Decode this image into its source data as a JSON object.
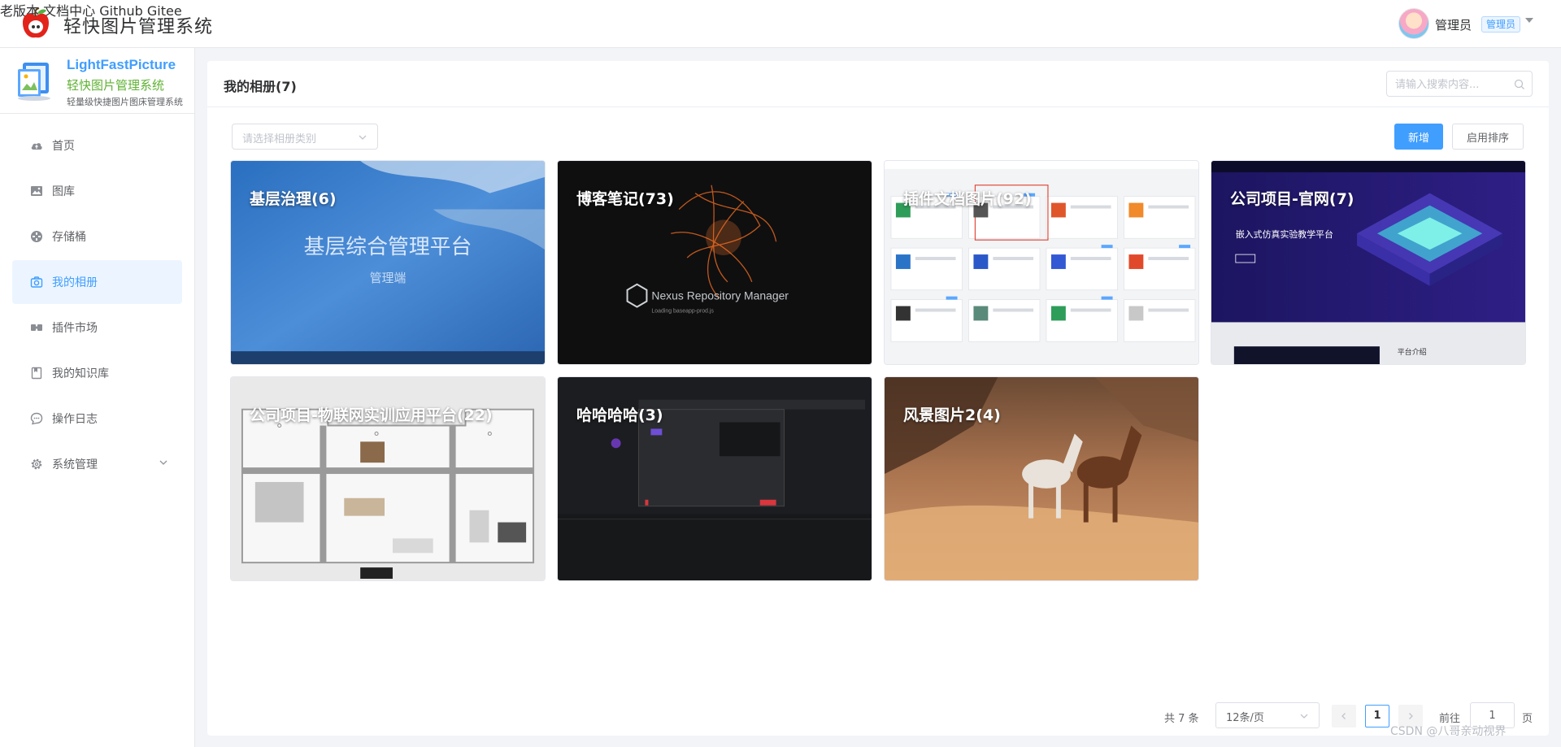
{
  "app": {
    "title": "轻快图片管理系统"
  },
  "topnav": {
    "links": [
      "老版本",
      "文档中心",
      "Github",
      "Gitee"
    ],
    "user_name": "管理员",
    "user_role": "管理员"
  },
  "sidebar": {
    "brand_en": "LightFastPicture",
    "brand_cn": "轻快图片管理系统",
    "brand_sub": "轻量级快捷图片图床管理系统",
    "items": [
      {
        "label": "首页",
        "icon": "cloud-icon"
      },
      {
        "label": "图库",
        "icon": "image-icon"
      },
      {
        "label": "存储桶",
        "icon": "bucket-icon"
      },
      {
        "label": "我的相册",
        "icon": "camera-icon",
        "active": true
      },
      {
        "label": "插件市场",
        "icon": "plugin-icon"
      },
      {
        "label": "我的知识库",
        "icon": "notebook-icon"
      },
      {
        "label": "操作日志",
        "icon": "chat-icon"
      },
      {
        "label": "系统管理",
        "icon": "gear-icon",
        "expandable": true
      }
    ]
  },
  "main": {
    "title": "我的相册(7)",
    "search_placeholder": "请输入搜索内容...",
    "category_placeholder": "请选择相册类别",
    "add_label": "新增",
    "sort_label": "启用排序"
  },
  "albums": [
    {
      "title": "基层治理(6)",
      "cover_text": "基层综合管理平台",
      "cover_sub": "管理端"
    },
    {
      "title": "博客笔记(73)",
      "cover_text": "Nexus Repository Manager",
      "cover_sub": "Loading baseapp-prod.js"
    },
    {
      "title": "插件文档图片(92)"
    },
    {
      "title": "公司项目-官网(7)",
      "cover_text": "嵌入式仿真实验教学平台",
      "cover_sub": "平台介绍"
    },
    {
      "title": "公司项目-物联网实训应用平台(22)"
    },
    {
      "title": "哈哈哈哈(3)"
    },
    {
      "title": "风景图片2(4)"
    }
  ],
  "pagination": {
    "total": "共 7 条",
    "page_size": "12条/页",
    "current_page": "1",
    "goto_label": "前往",
    "goto_value": "1",
    "page_suffix": "页"
  },
  "watermark": "CSDN @八哥亲动视界"
}
